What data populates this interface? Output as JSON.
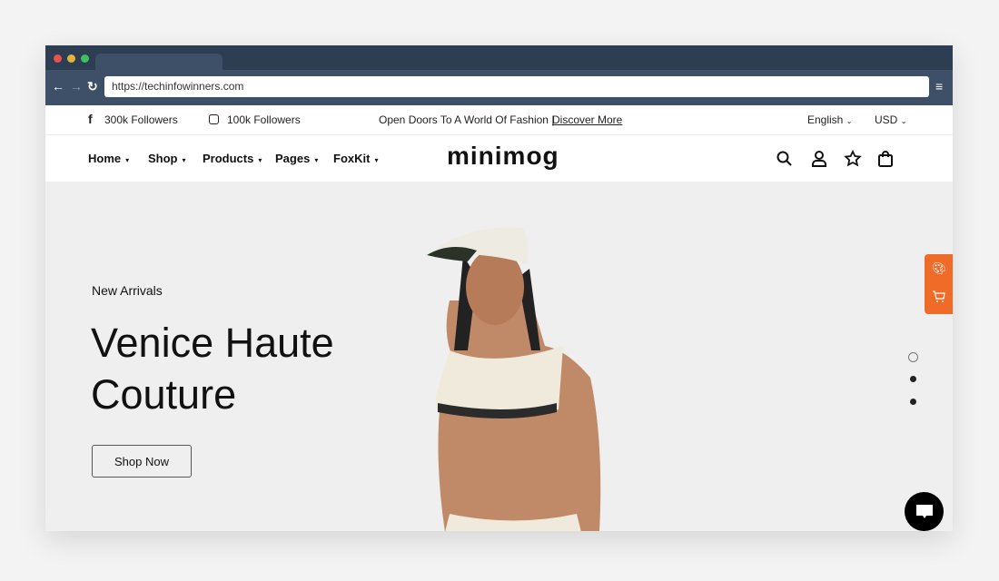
{
  "browser": {
    "url": "https://techinfowinners.com"
  },
  "topbar": {
    "facebook": "300k Followers",
    "instagram": "100k Followers",
    "promo": "Open Doors To A World Of Fashion |",
    "promo_link": "Discover More",
    "language": "English",
    "currency": "USD"
  },
  "nav": {
    "items": [
      "Home",
      "Shop",
      "Products",
      "Pages",
      "FoxKit"
    ],
    "logo": "minimog"
  },
  "hero": {
    "eyebrow": "New Arrivals",
    "title": "Venice Haute Couture",
    "button": "Shop Now",
    "slide_active": 1,
    "slide_count": 3
  },
  "colors": {
    "accent": "#f06a28",
    "chrome": "#2e3e52"
  }
}
